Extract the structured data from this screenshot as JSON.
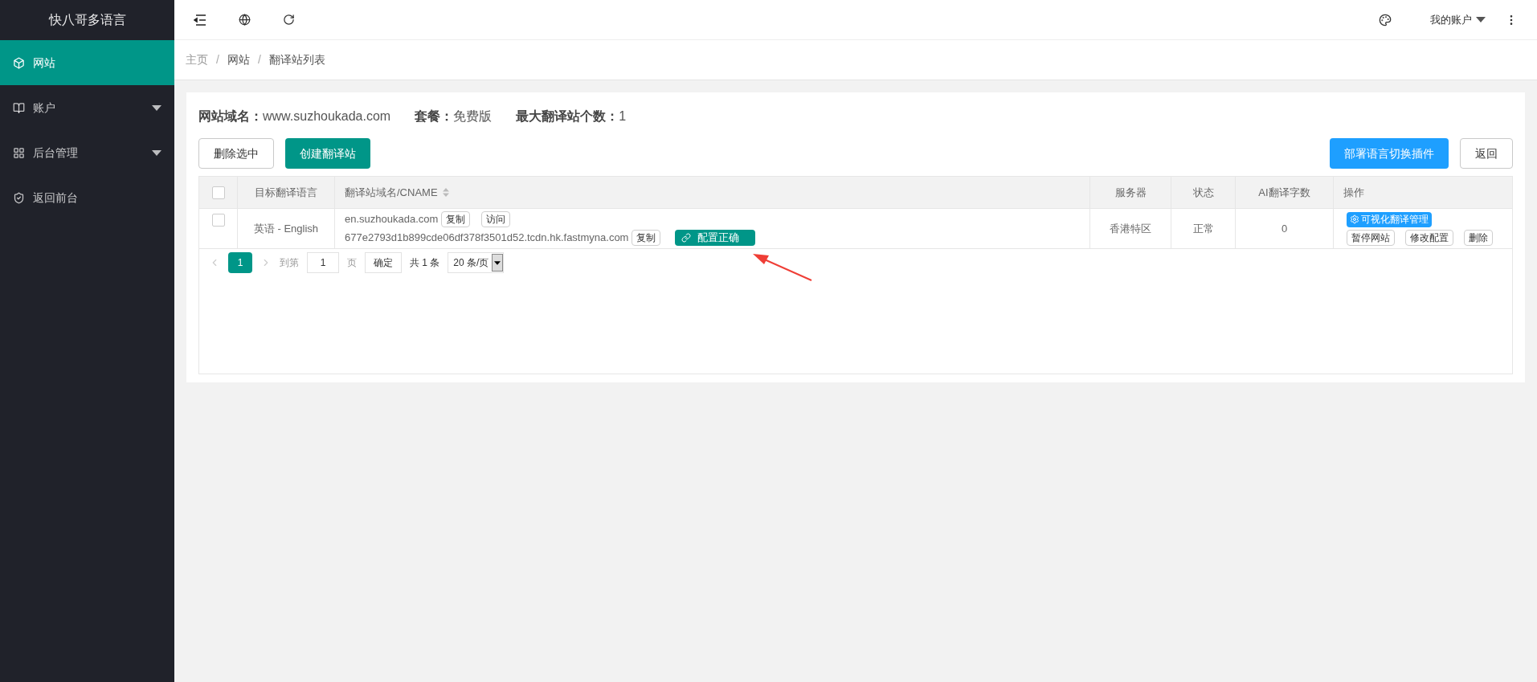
{
  "sidebar": {
    "title": "快八哥多语言",
    "items": [
      {
        "label": "网站",
        "selected": true,
        "expandable": false
      },
      {
        "label": "账户",
        "selected": false,
        "expandable": true
      },
      {
        "label": "后台管理",
        "selected": false,
        "expandable": true
      },
      {
        "label": "返回前台",
        "selected": false,
        "expandable": false
      }
    ]
  },
  "topbar": {
    "account": "我的账户"
  },
  "breadcrumb": [
    {
      "label": "主页"
    },
    {
      "separator": "/",
      "label": "网站"
    },
    {
      "separator": "/",
      "label": "翻译站列表"
    }
  ],
  "summary": [
    {
      "label": "网站域名：",
      "value": "www.suzhoukada.com"
    },
    {
      "label": "套餐：",
      "value": "免费版"
    },
    {
      "label": "最大翻译站个数：",
      "value": "1"
    }
  ],
  "actions_left": [
    "删除选中",
    "创建翻译站"
  ],
  "actions_right": [
    "部署语言切换插件",
    "返回"
  ],
  "table": {
    "select_all_checked": false,
    "columns": [
      "目标翻译语言",
      "翻译站域名/CNAME",
      "服务器",
      "状态",
      "AI翻译字数",
      "操作"
    ],
    "rows": [
      {
        "checked": false,
        "language": "英语 - English",
        "domain": "en.suzhoukada.com",
        "copy": "复制",
        "visit": "访问",
        "cname": "677e2793d1b899cde06df378f3501d52.tcdn.hk.fastmyna.com",
        "cname_copy": "复制",
        "config_status": "配置正确",
        "server": "香港特区",
        "status": "正常",
        "ai_chars": "0",
        "manage": "可视化翻译管理",
        "ops": [
          "暂停网站",
          "修改配置",
          "删除"
        ]
      }
    ]
  },
  "pagination": {
    "pages": [
      {
        "label": "1",
        "selected": true
      }
    ],
    "goto": "到第",
    "page_value": "1",
    "page_unit": "页",
    "confirm": "确定",
    "total": "共 1 条",
    "page_size": "20 条/页"
  }
}
